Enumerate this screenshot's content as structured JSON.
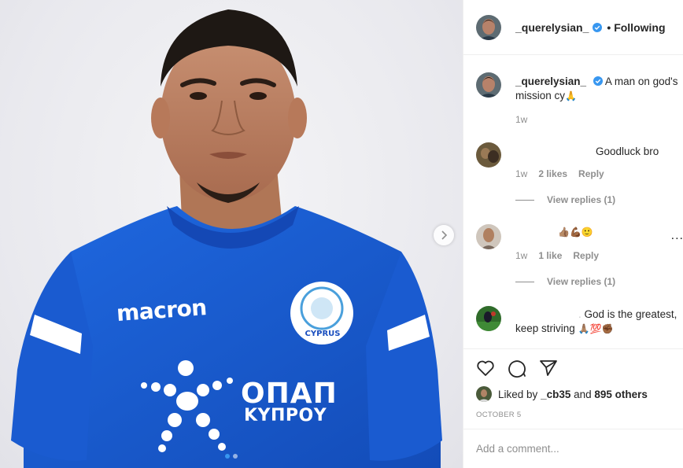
{
  "post": {
    "username": "_querelysian_",
    "follow_status": "Following",
    "jersey_brand": "macron",
    "jersey_sponsor_line1": "ОПАП",
    "jersey_sponsor_line2": "ΚΥΠΡΟΥ",
    "jersey_badge_text": "CYPRUS",
    "carousel_position": 1,
    "carousel_count": 2
  },
  "caption": {
    "username": "_querelysian_",
    "text": " A man on god's mission cy",
    "emoji": "🙏",
    "time": "1w"
  },
  "comments": [
    {
      "text": "Goodluck bro",
      "time": "1w",
      "likes": "2 likes",
      "reply": "Reply",
      "view_replies": "View replies (1)"
    },
    {
      "text": "👍🏽💪🏾🙂",
      "time": "1w",
      "likes": "1 like",
      "reply": "Reply",
      "view_replies": "View replies (1)",
      "more": "..."
    },
    {
      "text_prefix": ".",
      "text": "God is the greatest, keep striving",
      "emoji": "🙏🏽💯✊🏾"
    }
  ],
  "likes": {
    "prefix": "Liked by",
    "user": "_cb35",
    "joiner": "and",
    "others": "895 others"
  },
  "date": "OCTOBER 5",
  "add_comment": {
    "placeholder": "Add a comment..."
  },
  "colors": {
    "jersey_blue": "#1c5ed6",
    "link_blue": "#3897f0",
    "muted": "#8e8e8e",
    "text": "#262626"
  }
}
